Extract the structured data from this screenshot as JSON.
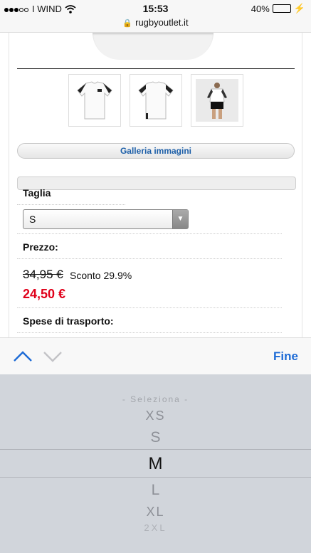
{
  "status": {
    "carrier": "I WIND",
    "time": "15:53",
    "battery": "40%",
    "battery_level": 0.4
  },
  "browser": {
    "url": "rugbyoutlet.it"
  },
  "product": {
    "gallery_button": "Galleria immagini",
    "size_label": "Taglia",
    "size_selected": "S",
    "price_label": "Prezzo:",
    "old_price": "34,95 €",
    "discount": "Sconto 29.9%",
    "new_price": "24,50 €",
    "shipping_label": "Spese di trasporto:"
  },
  "accessory": {
    "done_label": "Fine"
  },
  "picker": {
    "placeholder": "- Seleziona -",
    "options": [
      "XS",
      "S",
      "M",
      "L",
      "XL",
      "2XL"
    ],
    "selected": "M"
  }
}
